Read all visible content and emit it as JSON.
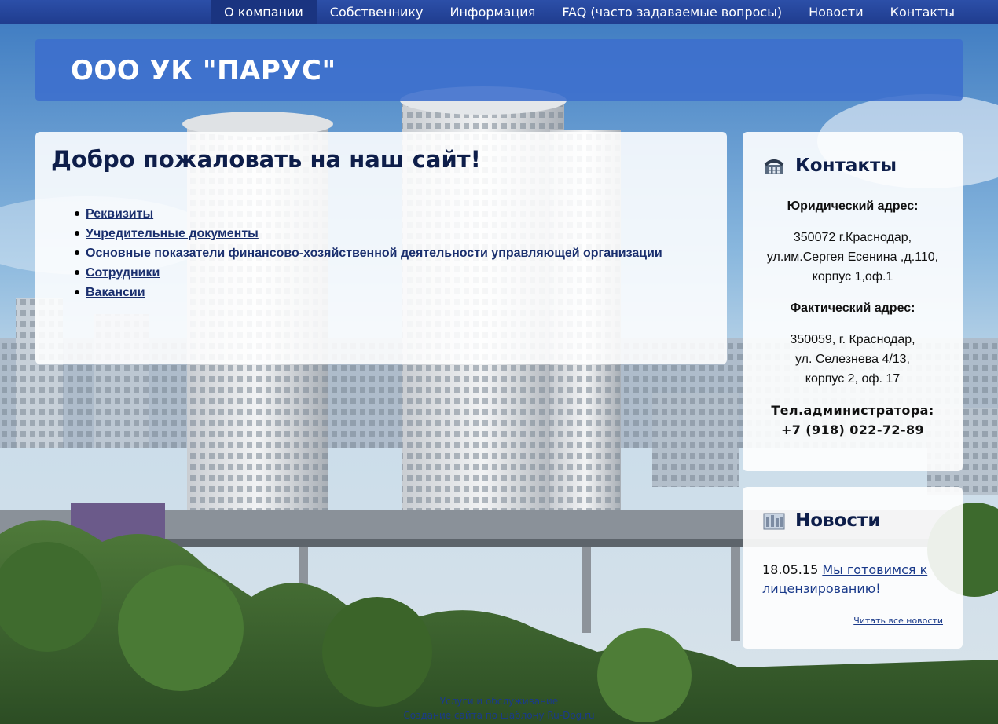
{
  "nav": {
    "items": [
      {
        "label": "О компании",
        "active": true
      },
      {
        "label": "Собственнику",
        "active": false
      },
      {
        "label": "Информация",
        "active": false
      },
      {
        "label": "FAQ (часто задаваемые вопросы)",
        "active": false
      },
      {
        "label": "Новости",
        "active": false
      },
      {
        "label": "Контакты",
        "active": false
      }
    ]
  },
  "header": {
    "title": "ООО УК \"ПАРУС\""
  },
  "main": {
    "title": "Добро пожаловать на наш сайт!",
    "links": [
      "Реквизиты",
      "Учредительные документы",
      "Основные показатели финансово-хозяйственной деятельности управляющей организации",
      "Сотрудники",
      "Вакансии"
    ]
  },
  "contacts": {
    "title": "Контакты",
    "icon": "phone-icon",
    "legal_label": "Юридический адрес:",
    "legal_lines": [
      "350072 г.Краснодар,",
      "ул.им.Сергея Есенина ,д.110,",
      "корпус 1,оф.1"
    ],
    "actual_label": "Фактический адрес:",
    "actual_lines": [
      "350059, г. Краснодар,",
      "ул. Селезнева 4/13,",
      "корпус 2, оф. 17"
    ],
    "phone_label": "Тел.администратора:",
    "phone": "+7 (918) 022-72-89"
  },
  "news": {
    "title": "Новости",
    "icon": "newspaper-icon",
    "date": "18.05.15",
    "headline": "Мы готовимся к лицензированию!",
    "all_link": "Читать все новости"
  },
  "footer": {
    "line1": "Услуги и обслуживание",
    "line2": "Создание сайта по шаблону Ru-Dog.ru"
  },
  "colors": {
    "nav_bg": "#1f3c8e",
    "header_bg": "#3c6ecd",
    "heading": "#0e1e4a",
    "link": "#1a2f6e"
  }
}
